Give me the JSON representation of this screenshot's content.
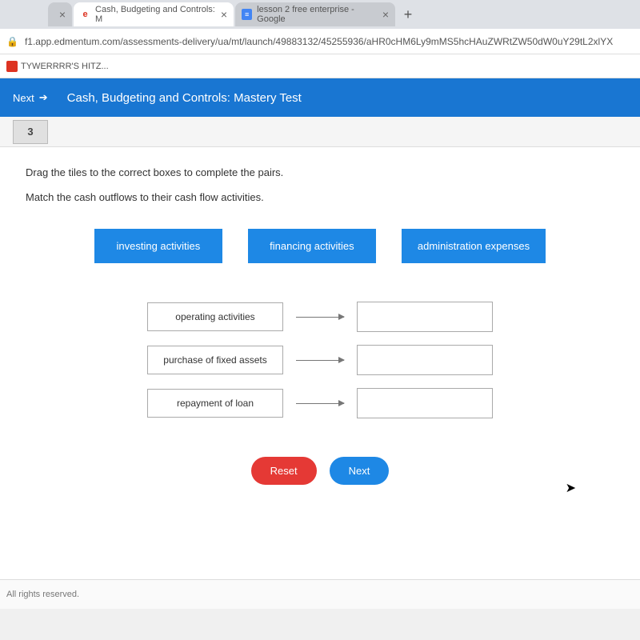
{
  "browser": {
    "tabs": [
      {
        "label": "Cash, Budgeting and Controls: M",
        "active": true
      },
      {
        "label": "lesson 2 free enterprise - Google",
        "active": false
      }
    ],
    "url": "f1.app.edmentum.com/assessments-delivery/ua/mt/launch/49883132/45255936/aHR0cHM6Ly9mMS5hcHAuZWRtZW50dW0uY29tL2xlYX",
    "bookmark": "TYWERRRR'S HITZ..."
  },
  "app": {
    "nav": "Next",
    "title": "Cash, Budgeting and Controls: Mastery Test"
  },
  "question": {
    "number": "3",
    "instruction1": "Drag the tiles to the correct boxes to complete the pairs.",
    "instruction2": "Match the cash outflows to their cash flow activities.",
    "tiles": [
      "investing activities",
      "financing activities",
      "administration expenses"
    ],
    "pairs": [
      "operating activities",
      "purchase of fixed assets",
      "repayment of loan"
    ],
    "reset": "Reset",
    "next": "Next"
  },
  "footer": "All rights reserved."
}
